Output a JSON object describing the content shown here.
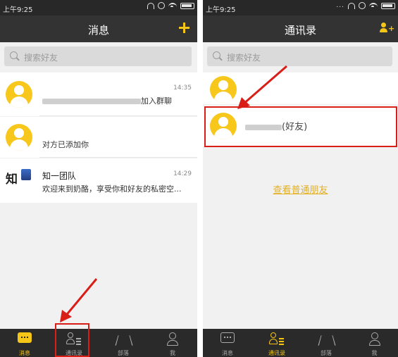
{
  "left": {
    "status": {
      "time": "上午9:25"
    },
    "header": {
      "title": "消息"
    },
    "search": {
      "placeholder": "搜索好友"
    },
    "chats": [
      {
        "preview": "加入群聊",
        "time": "14:35"
      },
      {
        "preview": "对方已添加你"
      },
      {
        "name": "知一团队",
        "preview": "欢迎来到奶酪，享受你和好友的私密空...",
        "time": "14:29",
        "logo_char": "知"
      }
    ],
    "tabs": [
      {
        "label": "消息",
        "icon": "chat-bubble-icon",
        "active": true
      },
      {
        "label": "通讯录",
        "icon": "contacts-icon"
      },
      {
        "label": "部落",
        "icon": "tent-icon"
      },
      {
        "label": "我",
        "icon": "person-icon"
      }
    ]
  },
  "right": {
    "status": {
      "time": "上午9:25",
      "dots": "..."
    },
    "header": {
      "title": "通讯录"
    },
    "search": {
      "placeholder": "搜索好友"
    },
    "friend": {
      "name_suffix": "(好友)"
    },
    "link": "查看普通朋友",
    "tabs": [
      {
        "label": "消息",
        "icon": "chat-bubble-icon"
      },
      {
        "label": "通讯录",
        "icon": "contacts-icon",
        "active": true
      },
      {
        "label": "部落",
        "icon": "tent-icon"
      },
      {
        "label": "我",
        "icon": "person-icon"
      }
    ]
  },
  "colors": {
    "accent": "#f5c518",
    "annotation_red": "#d91e18",
    "header_bg": "#333333",
    "tabbar_bg": "#2a2a2a"
  }
}
